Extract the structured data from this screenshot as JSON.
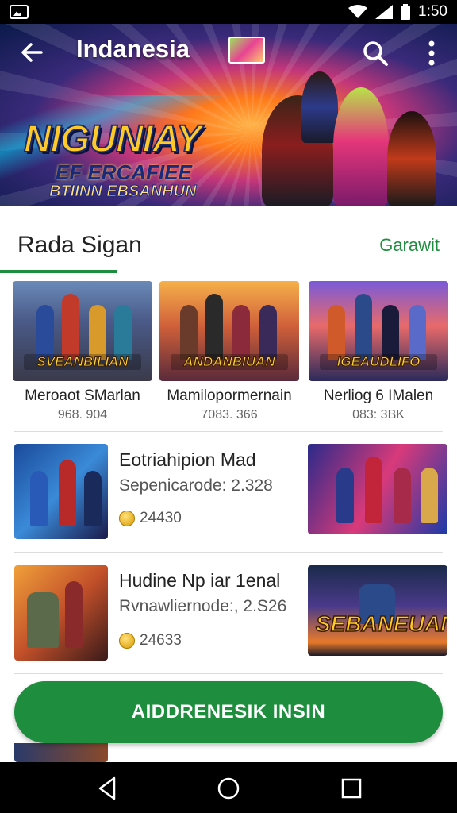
{
  "status_bar": {
    "time": "1:50"
  },
  "header": {
    "title": "Indanesia"
  },
  "banner": {
    "logo": "NIGUNIAY",
    "subtitle_1": "EF ERCAFIEE",
    "subtitle_2": "BTIINN EBSANHUN"
  },
  "section": {
    "title": "Rada Sigan",
    "see_all": "Garawit"
  },
  "tiles": [
    {
      "name": "Meroaot SMarlan",
      "meta": "968. 904",
      "caption": "SVEANBILIAN"
    },
    {
      "name": "Mamilopormernain",
      "meta": "7083. 366",
      "caption": "ANDANBIUAN"
    },
    {
      "name": "Nerliog 6 IMalen",
      "meta": "083: 3BK",
      "caption": "IGEAUDLIFO"
    }
  ],
  "rows": [
    {
      "title": "Eotriahipion Mad",
      "subtitle": "Sepenicarode: 2.328",
      "price": "24430"
    },
    {
      "title": "Hudine Np iar 1enal",
      "subtitle": "Rvnawliernode:, 2.S26",
      "price": "24633",
      "side_caption": "SEBANEUAN"
    }
  ],
  "cta": {
    "label": "AIDDRENESIK INSIN"
  },
  "colors": {
    "accent": "#1e8e3e",
    "status_bar": "#000000"
  }
}
